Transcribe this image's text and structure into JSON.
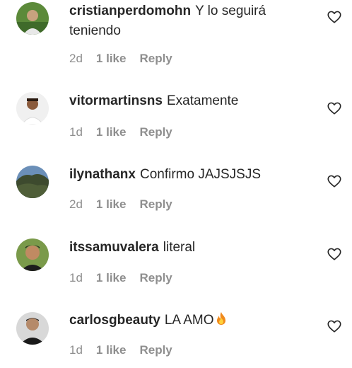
{
  "comments": [
    {
      "username": "cristianperdomohn",
      "text": "Y lo seguirá teniendo",
      "time": "2d",
      "likes": "1 like",
      "reply": "Reply",
      "avatar": "avatar-photo"
    },
    {
      "username": "vitormartinsns",
      "text": "Exatamente",
      "time": "1d",
      "likes": "1 like",
      "reply": "Reply",
      "avatar": "avatar-photo"
    },
    {
      "username": "ilynathanx",
      "text": "Confirmo JAJSJSJS",
      "time": "2d",
      "likes": "1 like",
      "reply": "Reply",
      "avatar": "avatar-photo"
    },
    {
      "username": "itssamuvalera",
      "text": "literal",
      "time": "1d",
      "likes": "1 like",
      "reply": "Reply",
      "avatar": "avatar-photo"
    },
    {
      "username": "carlosgbeauty",
      "text": "LA AMO",
      "time": "1d",
      "likes": "1 like",
      "reply": "Reply",
      "avatar": "avatar-photo",
      "emoji": "fire-emoji"
    }
  ],
  "icons": {
    "like": "heart-outline-icon"
  },
  "colors": {
    "text": "#262626",
    "meta": "#8e8e8e"
  }
}
